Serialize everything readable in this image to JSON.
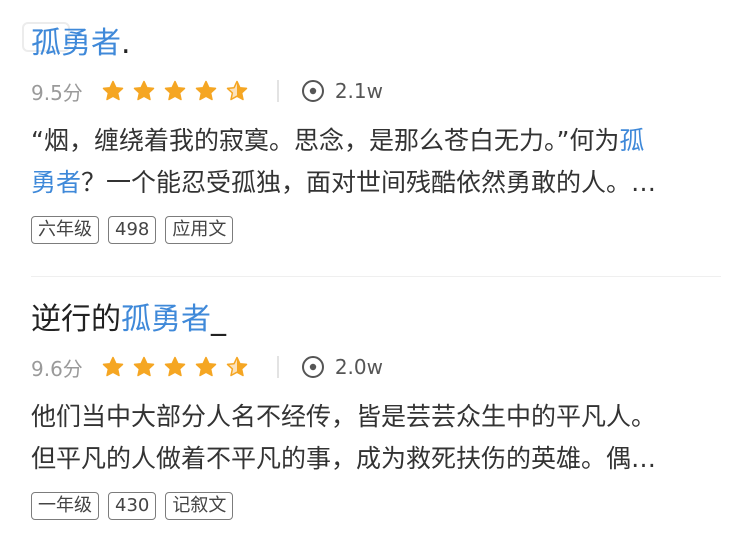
{
  "items": [
    {
      "title_prefix": "",
      "title_highlight": "孤勇者",
      "title_suffix": ".",
      "score": "9.5分",
      "views": "2.1w",
      "desc_line1_a": "“烟，缠绕着我的寂寞。思念，是那么苍白无力。”何为",
      "desc_line1_hl": "孤",
      "desc_line2_hl": "勇者",
      "desc_line2_b": "？一个能忍受孤独，面对世间残酷依然勇敢的人。…",
      "tags": [
        "六年级",
        "498",
        "应用文"
      ]
    },
    {
      "title_prefix": "逆行的",
      "title_highlight": "孤勇者",
      "title_suffix": "_",
      "score": "9.6分",
      "views": "2.0w",
      "desc_line1": "他们当中大部分人名不经传，皆是芸芸众生中的平凡人。",
      "desc_line2": "但平凡的人做着不平凡的事，成为救死扶伤的英雄。偶…",
      "tags": [
        "一年级",
        "430",
        "记叙文"
      ]
    }
  ],
  "colors": {
    "highlight": "#3f89d9",
    "star": "#f5a623",
    "meta": "#9a9a9a"
  },
  "icons": {
    "rating": "star-icon",
    "views": "eye-icon"
  }
}
